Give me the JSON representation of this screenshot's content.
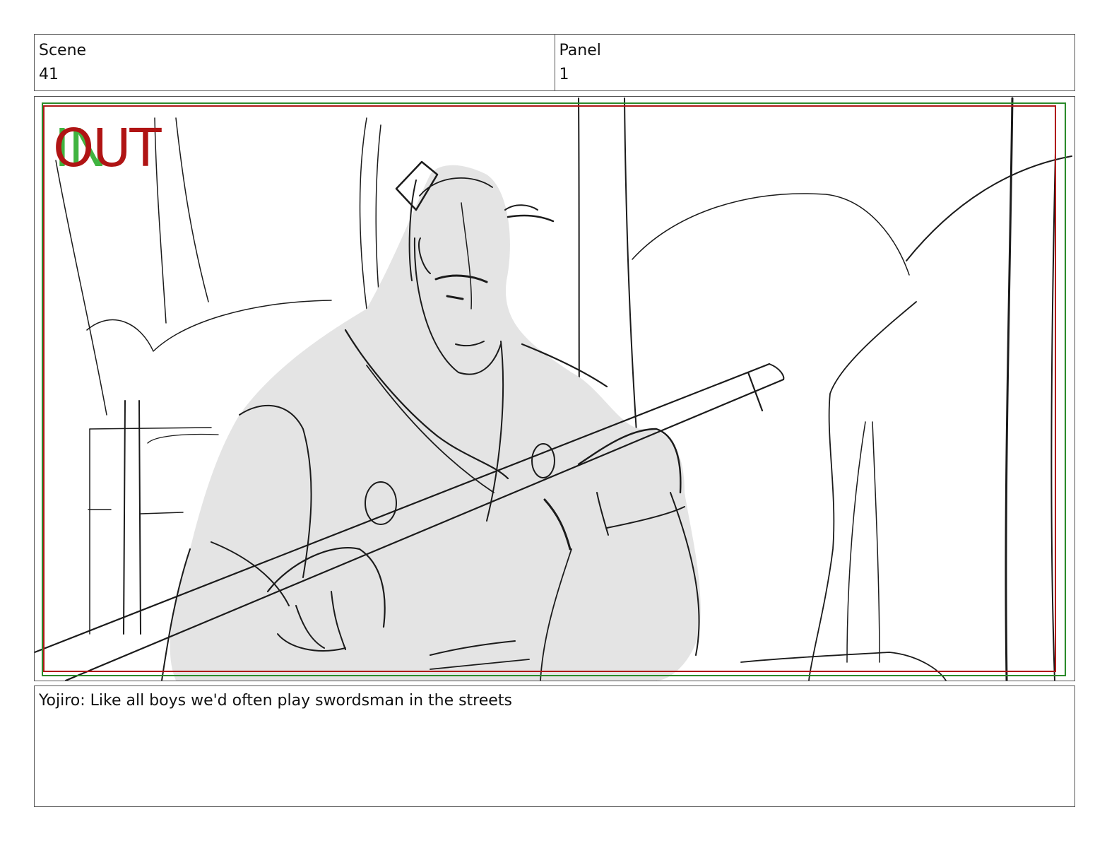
{
  "header": {
    "scene_label": "Scene",
    "scene_value": "41",
    "panel_label": "Panel",
    "panel_value": "1"
  },
  "frame": {
    "in_marker": "IN",
    "out_marker": "OUT",
    "colors": {
      "in_marker": "#36b036",
      "out_marker": "#b01414",
      "safe_green": "#2a8a2a",
      "safe_red": "#b01818",
      "shading": "#e4e4e4"
    }
  },
  "caption": {
    "text": "Yojiro: Like all boys we'd often play swordsman in the streets"
  }
}
